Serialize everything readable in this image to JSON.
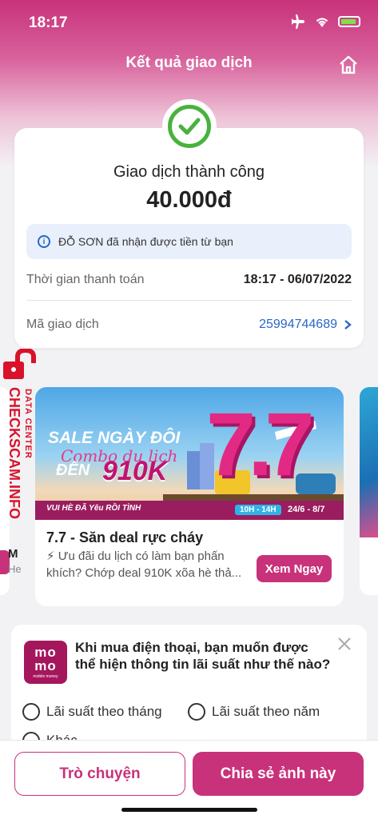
{
  "status_bar": {
    "time": "18:17"
  },
  "header": {
    "title": "Kết quả giao dịch"
  },
  "result": {
    "status": "Giao dịch thành công",
    "amount": "40.000đ",
    "info": "ĐỖ SƠN đã nhận được tiền từ bạn",
    "time_label": "Thời gian thanh toán",
    "time_value": "18:17 - 06/07/2022",
    "txn_label": "Mã giao dịch",
    "txn_value": "25994744689"
  },
  "side_label": {
    "top": "DATA CENTER",
    "main": "CHECKSCAM.INFO"
  },
  "promo": {
    "banner": {
      "sale": "SALE NGÀY ĐÔI",
      "combo": "Combo du lịch",
      "den": "ĐẾN",
      "amount": "910K",
      "big": "7.7",
      "tagline": "VUI HÈ ĐÃ Yêu RỒI TÌNH",
      "hours": "10H - 14H",
      "dates": "24/6 - 8/7"
    },
    "title": "7.7 - Săn deal rực cháy",
    "description": "⚡ Ưu đãi du lịch có làm bạn phấn khích? Chớp deal 910K xõa hè thả...",
    "button": "Xem Ngay",
    "next_title": "M",
    "next_desc": "He"
  },
  "survey": {
    "logo_top": "mo",
    "logo_bottom": "mo",
    "logo_sub": "mobile money",
    "question": "Khi mua điện thoại, bạn muốn được thể hiện thông tin lãi suất như thế nào?",
    "options": [
      "Lãi suất theo tháng",
      "Lãi suất theo năm",
      "Khác"
    ]
  },
  "actions": {
    "chat": "Trò chuyện",
    "share": "Chia sẻ ảnh này"
  },
  "colors": {
    "brand": "#c8327a",
    "success": "#48b23d",
    "link": "#2b66c8"
  }
}
